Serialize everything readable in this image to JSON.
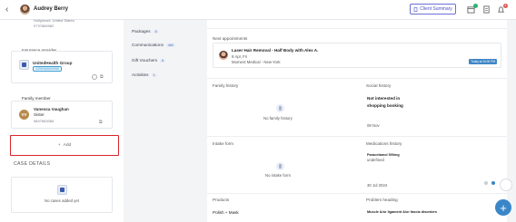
{
  "header": {
    "client_name": "Audrey Berry",
    "summary_label": "Client Summary",
    "badge_count": "8"
  },
  "left": {
    "address_line": "Hollywood, United States",
    "phone_line": "9737865982",
    "insurance_title": "Insurance provider",
    "insurance_name": "UnitedHealth Group",
    "insurance_id": "3395988659988",
    "family_title": "Family member",
    "family_initials": "VV",
    "family_name": "Vanessa Vaughan",
    "family_relation": "Sister",
    "family_phone": "9847863065",
    "add_label": "Add",
    "case_details_title": "CASE DETAILS",
    "no_cases_text": "No cases added yet"
  },
  "nav": {
    "items": [
      {
        "label": "Packages",
        "count": "6"
      },
      {
        "label": "Communications",
        "count": "462"
      },
      {
        "label": "Gift Vouchers",
        "count": "6"
      },
      {
        "label": "Activities",
        "count": "1"
      }
    ]
  },
  "right": {
    "next_appointments_title": "Next appointments",
    "appointment_title": "Laser Hair Removal - Half Body with Alex A.",
    "appointment_date": "8 Apr, Fri",
    "appointment_location": "Moment Medical - New York",
    "appointment_time": "Today at 10:00 PM",
    "family_history_title": "Family history",
    "no_family_history": "No family history",
    "social_history_title": "Social history",
    "social_history_value_1": "Not interested in",
    "social_history_value_2": "shopping booking",
    "social_history_date": "08 Nov",
    "intake_form_title": "Intake form",
    "no_intake_form": "No intake form",
    "medications_title": "Medications history",
    "medication_name": "Paracetamol 500mg",
    "medication_sub": "undefined",
    "medication_date": "30 Jul 2024",
    "products_title": "Products",
    "product_value": "Polish + Mask",
    "problem_title": "Problem heading",
    "problem_value": "Muscle &/or ligament &/or fascia disorders"
  }
}
